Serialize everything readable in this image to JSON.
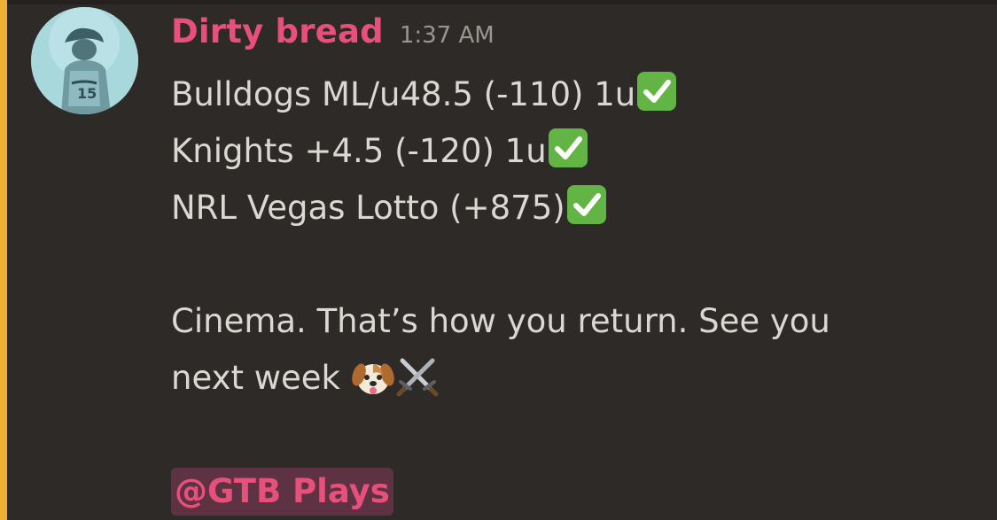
{
  "message": {
    "author": "Dirty bread",
    "timestamp": "1:37 AM",
    "avatar_icon": "avatar-image",
    "lines": [
      "Bulldogs ML/u48.5 (-110) 1u",
      "Knights +4.5 (-120) 1u",
      "NRL Vegas Lotto (+875)",
      "",
      "Cinema. That’s how you return. See you",
      "next week "
    ],
    "check_icon": "check-mark-button-icon",
    "dog_icon": "dog-face-icon",
    "swords_icon": "crossed-swords-icon",
    "mention": "@GTB Plays"
  },
  "colors": {
    "background": "#2e2a27",
    "mention_bar": "#f0b132",
    "author": "#e8507c",
    "mention_bg": "#5d3343",
    "text": "#dbd7d2",
    "timestamp": "#9a9590",
    "check_green": "#62b545"
  }
}
